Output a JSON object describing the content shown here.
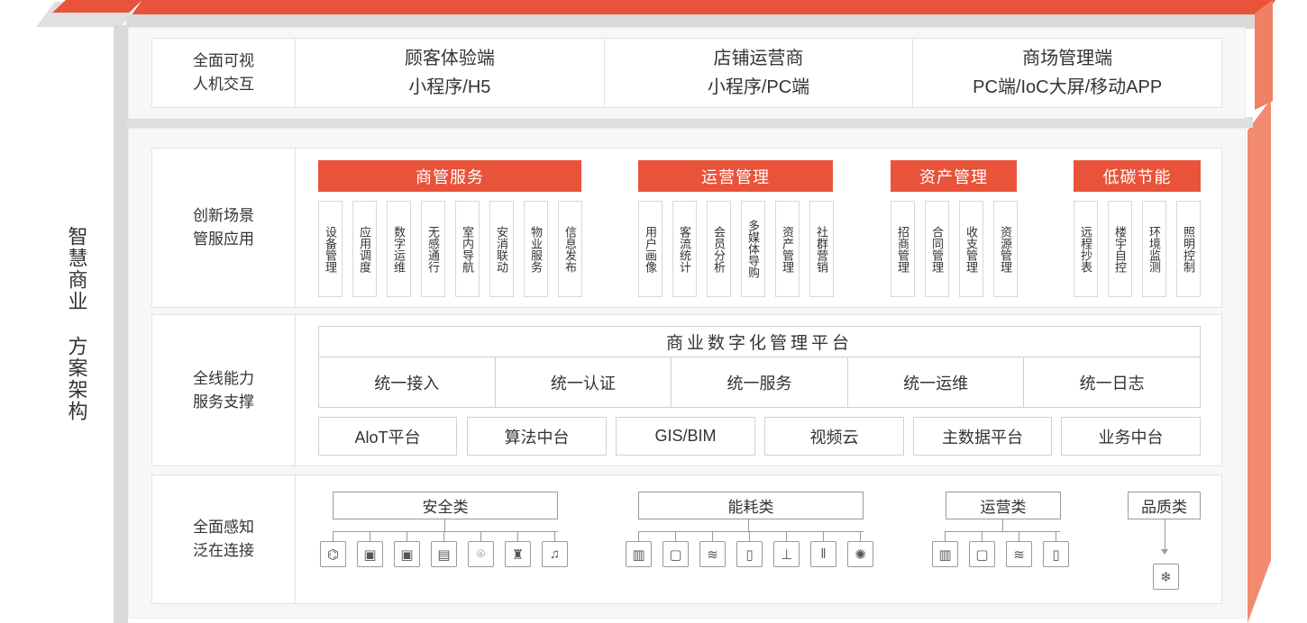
{
  "side_title": [
    "智慧商业",
    "方案架构"
  ],
  "layers": [
    {
      "label": "全面可视\n人机交互"
    },
    {
      "label": "创新场景\n管服应用"
    },
    {
      "label": "全线能力\n服务支撑"
    },
    {
      "label": "全面感知\n泛在连接"
    }
  ],
  "top_clients": [
    {
      "line1": "顾客体验端",
      "line2": "小程序/H5"
    },
    {
      "line1": "店铺运营商",
      "line2": "小程序/PC端"
    },
    {
      "line1": "商场管理端",
      "line2": "PC端/IoC大屏/移动APP"
    }
  ],
  "scenario_groups": [
    {
      "title": "商管服务",
      "items": [
        "设备管理",
        "应用调度",
        "数字运维",
        "无感通行",
        "室内导航",
        "安消联动",
        "物业服务",
        "信息发布"
      ]
    },
    {
      "title": "运营管理",
      "items": [
        "用户画像",
        "客流统计",
        "会员分析",
        "多媒体导购",
        "资产管理",
        "社群营销"
      ]
    },
    {
      "title": "资产管理",
      "items": [
        "招商管理",
        "合同管理",
        "收支管理",
        "资源管理"
      ]
    },
    {
      "title": "低碳节能",
      "items": [
        "远程抄表",
        "楼宇自控",
        "环境监测",
        "照明控制"
      ]
    }
  ],
  "platform": {
    "title": "商业数字化管理平台",
    "unified": [
      "统一接入",
      "统一认证",
      "统一服务",
      "统一运维",
      "统一日志"
    ],
    "middle": [
      "AloT平台",
      "算法中台",
      "GIS/BIM",
      "视频云",
      "主数据平台",
      "业务中台"
    ]
  },
  "perception": [
    {
      "title": "安全类",
      "icons": [
        "camera-icon",
        "access-card-icon",
        "door-lock-icon",
        "fire-panel-icon",
        "location-icon",
        "fire-hydrant-icon",
        "alarm-bell-icon"
      ]
    },
    {
      "title": "能耗类",
      "icons": [
        "electric-meter-icon",
        "water-meter-icon",
        "air-conditioner-icon",
        "power-socket-icon",
        "valve-icon",
        "distribution-cabinet-icon",
        "light-sensor-icon"
      ]
    },
    {
      "title": "运营类",
      "icons": [
        "meter-icon",
        "screen-icon",
        "air-conditioner-icon",
        "socket-icon"
      ]
    },
    {
      "title": "品质类",
      "icons": [
        "temperature-humidity-icon"
      ]
    }
  ],
  "colors": {
    "accent": "#e8533a",
    "frame": "#d6d6d6"
  }
}
